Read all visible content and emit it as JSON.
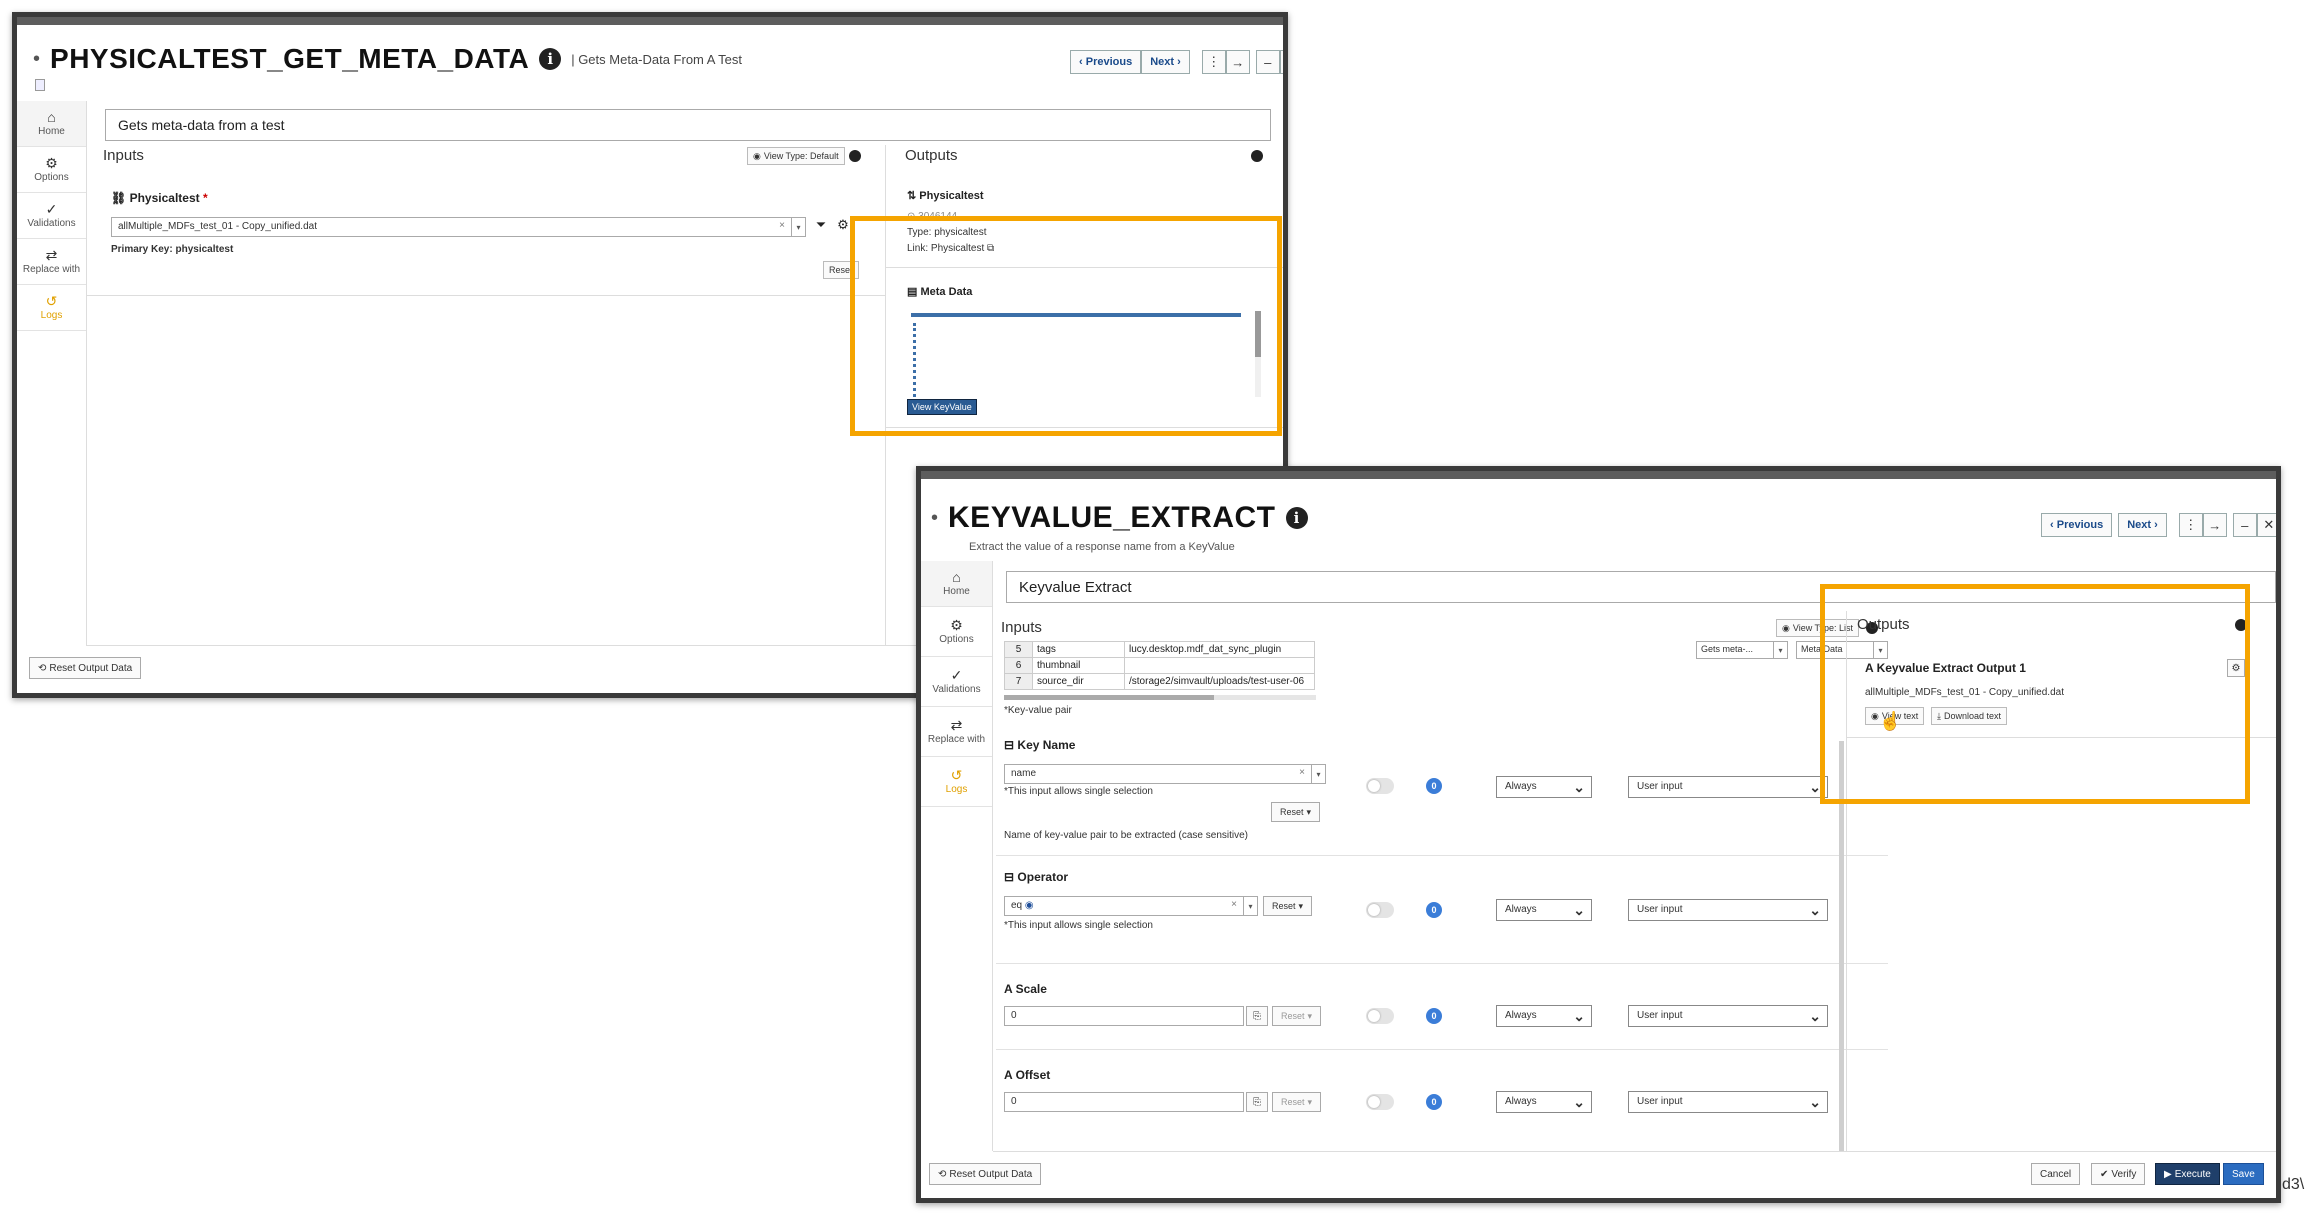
{
  "window1": {
    "title": "PHYSICALTEST_GET_META_DATA",
    "subtitle": "| Gets Meta-Data From A Test",
    "nav": {
      "previous": "Previous",
      "next": "Next"
    },
    "sidebar": [
      {
        "icon": "home-icon",
        "label": "Home"
      },
      {
        "icon": "gear-icon",
        "label": "Options"
      },
      {
        "icon": "check-icon",
        "label": "Validations"
      },
      {
        "icon": "swap-icon",
        "label": "Replace with"
      },
      {
        "icon": "history-icon",
        "label": "Logs"
      }
    ],
    "description": "Gets meta-data from a test",
    "inputs_label": "Inputs",
    "view_type": "View Type: Default",
    "input_name": "Physicaltest",
    "input_value": "allMultiple_MDFs_test_01 - Copy_unified.dat",
    "primary_key": "Primary Key: physicaltest",
    "reset": "Reset",
    "outputs_label": "Outputs",
    "output_name": "Physicaltest",
    "output_id": "3046144",
    "output_type": "Type: physicaltest",
    "output_link": "Link: Physicaltest",
    "meta_label": "Meta Data",
    "view_keyvalue": "View KeyValue",
    "reset_output": "Reset Output Data"
  },
  "window2": {
    "title": "KEYVALUE_EXTRACT",
    "subtitle": "Extract the value of a response name from a KeyValue",
    "nav": {
      "previous": "Previous",
      "next": "Next"
    },
    "sidebar": [
      {
        "icon": "home-icon",
        "label": "Home"
      },
      {
        "icon": "gear-icon",
        "label": "Options"
      },
      {
        "icon": "check-icon",
        "label": "Validations"
      },
      {
        "icon": "swap-icon",
        "label": "Replace with"
      },
      {
        "icon": "history-icon",
        "label": "Logs"
      }
    ],
    "description": "Keyvalue Extract",
    "inputs_label": "Inputs",
    "view_type": "View Type: List",
    "src_select_1": "Gets meta-...",
    "src_select_2": "Meta Data",
    "kv_rows": [
      {
        "n": "5",
        "key": "tags",
        "value": "lucy.desktop.mdf_dat_sync_plugin"
      },
      {
        "n": "6",
        "key": "thumbnail",
        "value": ""
      },
      {
        "n": "7",
        "key": "source_dir",
        "value": "/storage2/simvault/uploads/test-user-06"
      }
    ],
    "kv_note": "*Key-value pair",
    "key_name": {
      "label": "Key Name",
      "value": "name",
      "note": "*This input allows single selection",
      "reset": "Reset",
      "help": "Name of key-value pair to be extracted (case sensitive)",
      "mode": "Always",
      "source": "User input"
    },
    "operator": {
      "label": "Operator",
      "value": "eq",
      "note": "*This input allows single selection",
      "reset": "Reset",
      "mode": "Always",
      "source": "User input"
    },
    "scale": {
      "label": "Scale",
      "value": "0",
      "reset": "Reset",
      "mode": "Always",
      "source": "User input"
    },
    "offset": {
      "label": "Offset",
      "value": "0",
      "reset": "Reset",
      "mode": "Always",
      "source": "User input"
    },
    "badge": "0",
    "outputs_label": "Outputs",
    "output_name": "Keyvalue Extract Output 1",
    "output_value": "allMultiple_MDFs_test_01 - Copy_unified.dat",
    "view_text": "View text",
    "download_text": "Download text",
    "reset_output": "Reset Output Data",
    "footer": {
      "cancel": "Cancel",
      "verify": "Verify",
      "execute": "Execute",
      "save": "Save"
    }
  },
  "edge_text": "d3\\",
  "colors": {
    "highlight": "#f5a400",
    "primary": "#1f3f6a",
    "accent": "#2b6cc0"
  }
}
